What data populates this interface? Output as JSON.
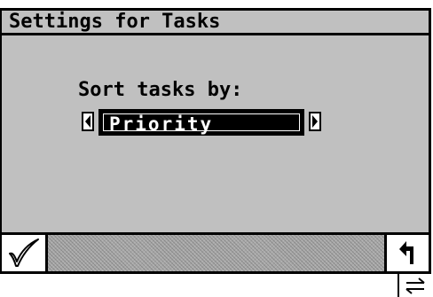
{
  "window": {
    "title": "Settings for Tasks"
  },
  "settings": {
    "sort_label": "Sort tasks by:",
    "sort_value": "Priority"
  },
  "toolbar": {
    "ok_icon": "checkmark-icon",
    "back_icon": "return-arrow-icon"
  },
  "status": {
    "switch_icon": "switch-arrows-icon"
  },
  "colors": {
    "background": "#c0c0c0",
    "selected": "#000000",
    "selected_text": "#ffffff"
  }
}
